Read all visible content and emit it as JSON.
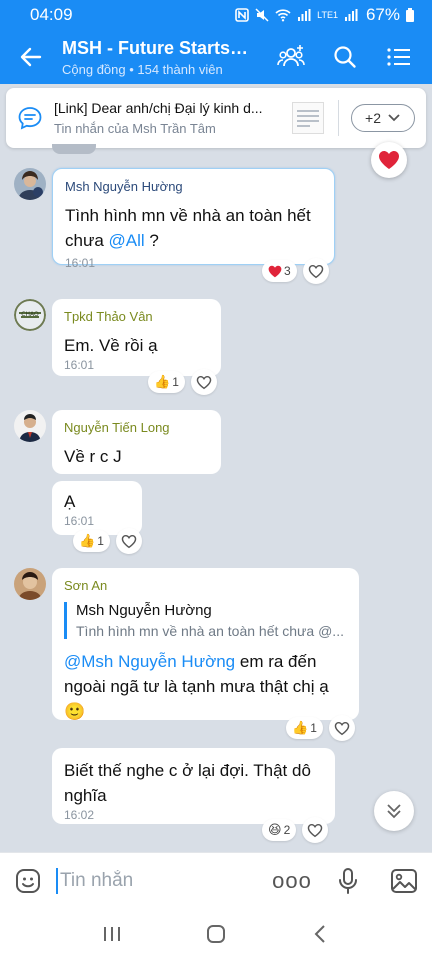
{
  "status_bar": {
    "time": "04:09",
    "network": "LTE1",
    "battery": "67%"
  },
  "header": {
    "title": "MSH - Future Starts H...",
    "subtitle": "Cộng đồng • 154 thành viên"
  },
  "pinned": {
    "title": "[Link] Dear anh/chị Đại lý kinh d...",
    "subtitle": "Tin nhắn của Msh Trần Tâm",
    "more": "+2"
  },
  "messages": [
    {
      "sender": "Msh Nguyễn Hường",
      "sender_color": "#2c4a7a",
      "text": "Tình hình mn về nhà an toàn hết chưa ",
      "mention": "@All",
      "text_after": " ?",
      "time": "16:01",
      "reaction": {
        "icon": "heart-icon",
        "count": "3"
      }
    },
    {
      "sender": "Tpkd Thảo Vân",
      "sender_color": "#7a8a1f",
      "text": "Em. Về rồi ạ",
      "time": "16:01",
      "reaction": {
        "icon": "thumbs-up-icon",
        "count": "1"
      }
    },
    {
      "sender": "Nguyễn Tiến Long",
      "sender_color": "#7a8a1f",
      "text": "Về r c J",
      "text2": "Ạ",
      "time": "16:01",
      "reaction": {
        "icon": "thumbs-up-icon",
        "count": "1"
      }
    },
    {
      "sender": "Sơn An",
      "sender_color": "#7a8a1f",
      "quote_name": "Msh Nguyễn Hường",
      "quote_text": "Tình hình mn về nhà an toàn hết chưa @...",
      "mention": "@Msh Nguyễn Hường",
      "text": " em ra đến ngoài ngã tư là tạnh mưa thật chị ạ",
      "emoji": "🙂",
      "time": "",
      "reaction": {
        "icon": "thumbs-up-icon",
        "count": "1"
      },
      "text2": "Biết thế nghe c ở lại đợi. Thật dô nghĩa",
      "time2": "16:02",
      "reaction2": {
        "icon": "laughing-icon",
        "count": "2"
      }
    }
  ],
  "composer": {
    "placeholder": "Tin nhắn",
    "more": "ooo"
  },
  "colors": {
    "accent": "#1a8cf5",
    "background": "#d8dee6"
  }
}
